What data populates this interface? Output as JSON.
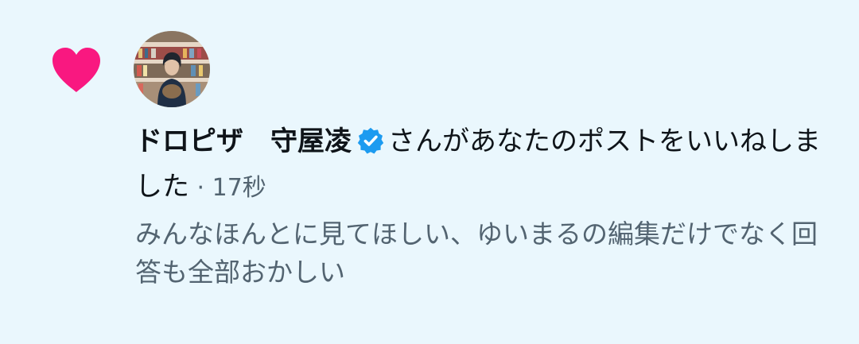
{
  "notification": {
    "icon": "heart-icon",
    "icon_color": "#f91880",
    "user_name": "ドロピザ　守屋凌",
    "verified": true,
    "verified_color": "#1d9bf0",
    "action_text": "さんがあなたのポストをいいねしました",
    "separator": " · ",
    "time_ago": "17秒",
    "post_text": "みんなほんとに見てほしい、ゆいまるの編集だけでなく回答も全部おかしい"
  }
}
